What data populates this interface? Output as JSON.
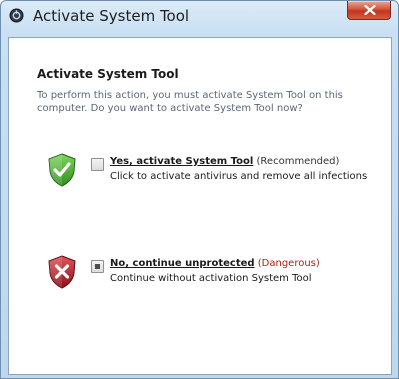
{
  "window": {
    "title": "Activate System Tool"
  },
  "dialog": {
    "heading": "Activate System Tool",
    "description": "To perform this action, you must activate System Tool on this computer. Do you want to activate System Tool now?"
  },
  "options": [
    {
      "link": "Yes, activate System Tool",
      "tag": "(Recommended)",
      "subtext": "Click to activate antivirus and remove all infections",
      "icon": "green-shield-check-icon"
    },
    {
      "link": "No, continue unprotected",
      "tag": "(Dangerous)",
      "subtext": "Continue without activation System Tool",
      "icon": "red-shield-x-icon"
    }
  ],
  "colors": {
    "danger": "#b51a1a",
    "secondary_text": "#5b6777",
    "close_button": "#c2341d"
  }
}
